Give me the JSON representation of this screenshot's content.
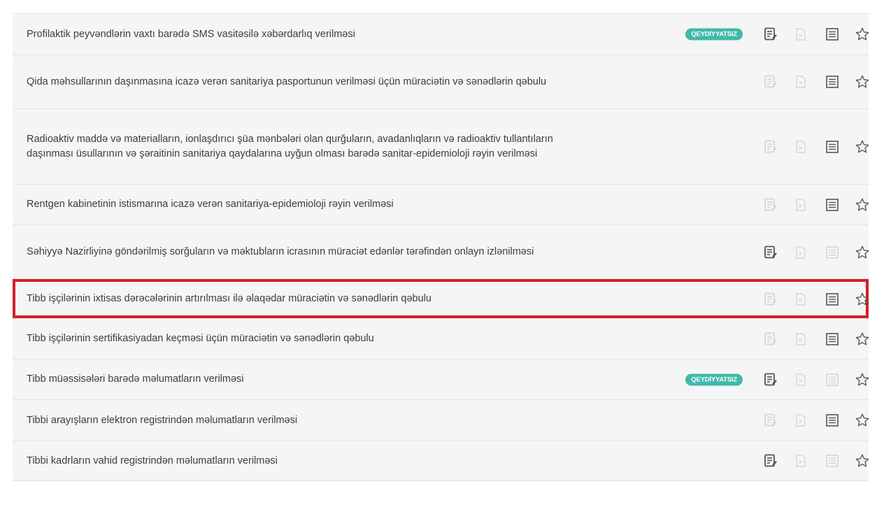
{
  "services": [
    {
      "title": "Profilaktik peyvəndlərin vaxtı barədə SMS vasitəsilə xəbərdarlıq verilməsi",
      "badge": "QEYDİYYATSIZ",
      "e_service": true,
      "template": false,
      "info": true
    },
    {
      "title": "Qida məhsullarının daşınmasına icazə verən sanitariya pasportunun verilməsi üçün müraciətin və sənədlərin qəbulu",
      "badge": "",
      "e_service": false,
      "template": false,
      "info": true
    },
    {
      "title": "Radioaktiv maddə və materialların, ionlaşdırıcı şüa mənbələri olan qurğuların, avadanlıqların və radioaktiv tullantıların daşınması üsullarının və şəraitinin sanitariya qaydalarına uyğun olması barədə sanitar-epidemioloji rəyin verilməsi",
      "badge": "",
      "e_service": false,
      "template": false,
      "info": true
    },
    {
      "title": "Rentgen kabinetinin istismarına icazə verən sanitariya-epidemioloji rəyin verilməsi",
      "badge": "",
      "e_service": false,
      "template": false,
      "info": true
    },
    {
      "title": "Səhiyyə Nazirliyinə göndərilmiş sorğuların və məktubların icrasının müraciət edənlər tərəfindən onlayn izlənilməsi",
      "badge": "",
      "e_service": true,
      "template": false,
      "info": false
    },
    {
      "title": "Tibb işçilərinin ixtisas dərəcələrinin artırılması ilə əlaqədar müraciətin və sənədlərin qəbulu",
      "badge": "",
      "e_service": false,
      "template": false,
      "info": true,
      "highlighted": true
    },
    {
      "title": "Tibb işçilərinin sertifikasiyadan keçməsi üçün müraciətin və sənədlərin qəbulu",
      "badge": "",
      "e_service": false,
      "template": false,
      "info": true
    },
    {
      "title": "Tibb müəssisələri barədə məlumatların verilməsi",
      "badge": "QEYDİYYATSIZ",
      "e_service": true,
      "template": false,
      "info": false
    },
    {
      "title": "Tibbi arayışların elektron registrindən məlumatların verilməsi",
      "badge": "",
      "e_service": false,
      "template": false,
      "info": true
    },
    {
      "title": "Tibbi kadrların vahid registrindən məlumatların verilməsi",
      "badge": "",
      "e_service": true,
      "template": false,
      "info": false
    }
  ],
  "icons": {
    "e_service": "e-service-icon",
    "template": "document-template-icon",
    "info": "info-list-icon",
    "favorite": "star-icon"
  },
  "colors": {
    "badge": "#3fb9a9",
    "highlight": "#d11f2a",
    "icon_active": "#555555",
    "icon_inactive": "#d6d6d6",
    "row_background": "#f5f5f5"
  }
}
